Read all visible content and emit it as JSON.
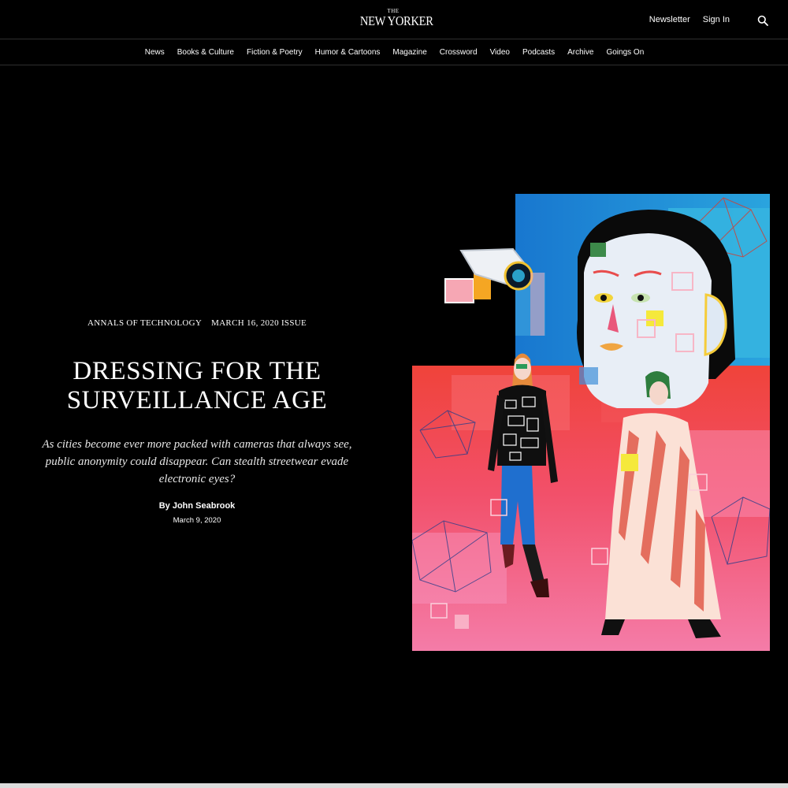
{
  "header": {
    "logo_small": "THE",
    "logo_main": "NEW YORKER",
    "newsletter_label": "Newsletter",
    "signin_label": "Sign In",
    "search_icon": "search-icon"
  },
  "nav": {
    "items": [
      {
        "label": "News"
      },
      {
        "label": "Books & Culture"
      },
      {
        "label": "Fiction & Poetry"
      },
      {
        "label": "Humor & Cartoons"
      },
      {
        "label": "Magazine"
      },
      {
        "label": "Crossword"
      },
      {
        "label": "Video"
      },
      {
        "label": "Podcasts"
      },
      {
        "label": "Archive"
      },
      {
        "label": "Goings On"
      }
    ]
  },
  "article": {
    "rubric": "ANNALS OF TECHNOLOGY",
    "issue": "MARCH 16, 2020 ISSUE",
    "headline_line1": "DRESSING FOR THE",
    "headline_line2": "SURVEILLANCE AGE",
    "dek": "As cities become ever more packed with cameras that always see, public anonymity could disappear. Can stealth streetwear evade electronic eyes?",
    "byline": "By John Seabrook",
    "date": "March 9, 2020"
  },
  "colors": {
    "background": "#000000",
    "text": "#ffffff",
    "rule": "#2e2e2e",
    "art_blue": "#1f88d6",
    "art_red": "#f0433a",
    "art_pink": "#f46c9f"
  }
}
